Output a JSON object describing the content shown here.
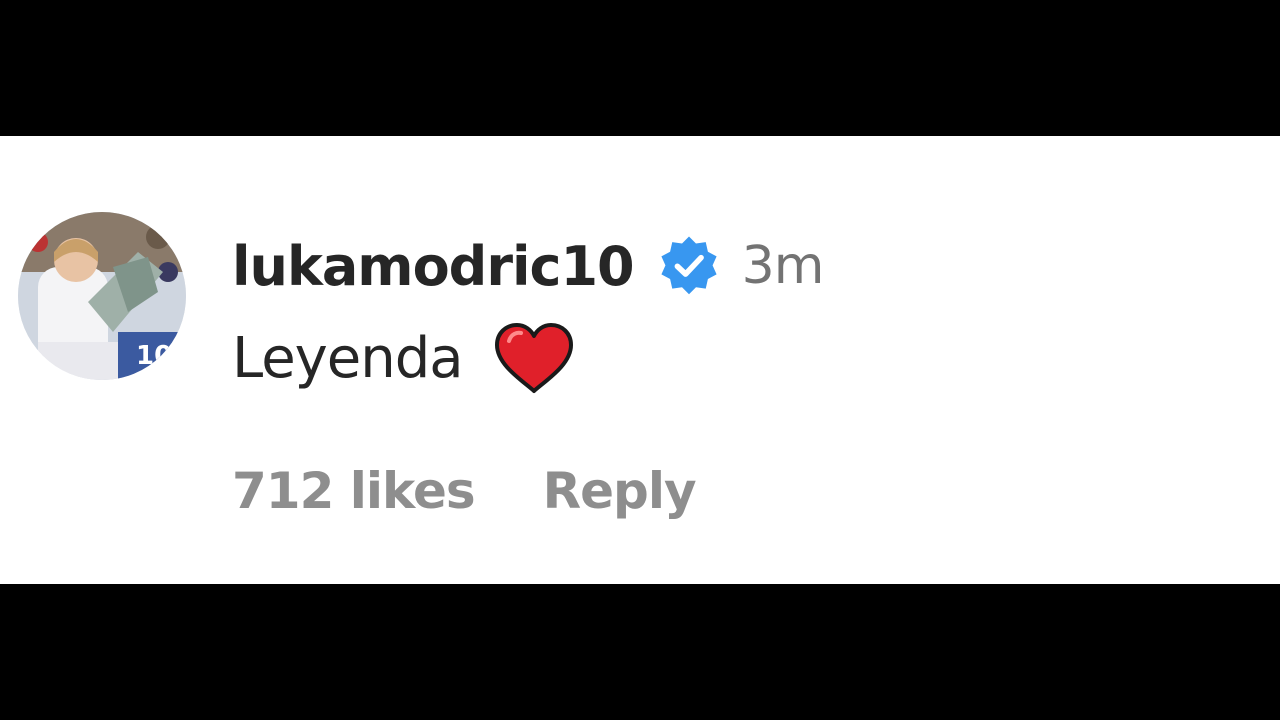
{
  "comment": {
    "avatar_icon": "profile-photo-avatar",
    "username": "lukamodric10",
    "verified_icon": "verified-badge-icon",
    "verified_color": "#3897f0",
    "timestamp": "3m",
    "text": "Leyenda",
    "emoji_icon": "red-heart-emoji",
    "emoji_color": "#e0202a",
    "likes": "712 likes",
    "reply_label": "Reply"
  }
}
